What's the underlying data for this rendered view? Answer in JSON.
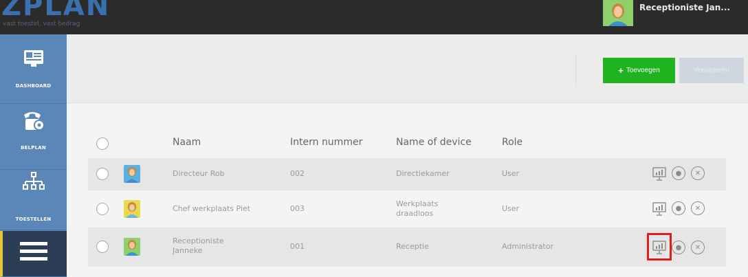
{
  "app": {
    "logo_text": "ZPLAN",
    "tagline": "vast toestel, vast bedrag",
    "user_name": "Receptioniste Jan..."
  },
  "sidebar": {
    "items": [
      {
        "label": "DASHBOARD",
        "icon": "dashboard-icon"
      },
      {
        "label": "BELPLAN",
        "icon": "phone-settings-icon"
      },
      {
        "label": "TOESTELLEN",
        "icon": "network-devices-icon"
      },
      {
        "label": "",
        "icon": "menu-icon",
        "active": true
      }
    ]
  },
  "toolbar": {
    "add_label": "Toevoegen",
    "delete_label": "Verwijderen"
  },
  "table": {
    "columns": [
      "Naam",
      "Intern nummer",
      "Name of device",
      "Role"
    ],
    "rows": [
      {
        "name": "Directeur Rob",
        "intern": "002",
        "device": "Directiekamer",
        "role": "User"
      },
      {
        "name": "Chef werkplaats Piet",
        "intern": "003",
        "device": "Werkplaats draadloos",
        "role": "User"
      },
      {
        "name": "Receptioniste Janneke",
        "intern": "001",
        "device": "Receptie",
        "role": "Administrator"
      }
    ]
  },
  "colors": {
    "topbar": "#2b2b2b",
    "sidebar": "#5b87b8",
    "add_button": "#1fb31f",
    "highlight": "#e21b1b"
  }
}
